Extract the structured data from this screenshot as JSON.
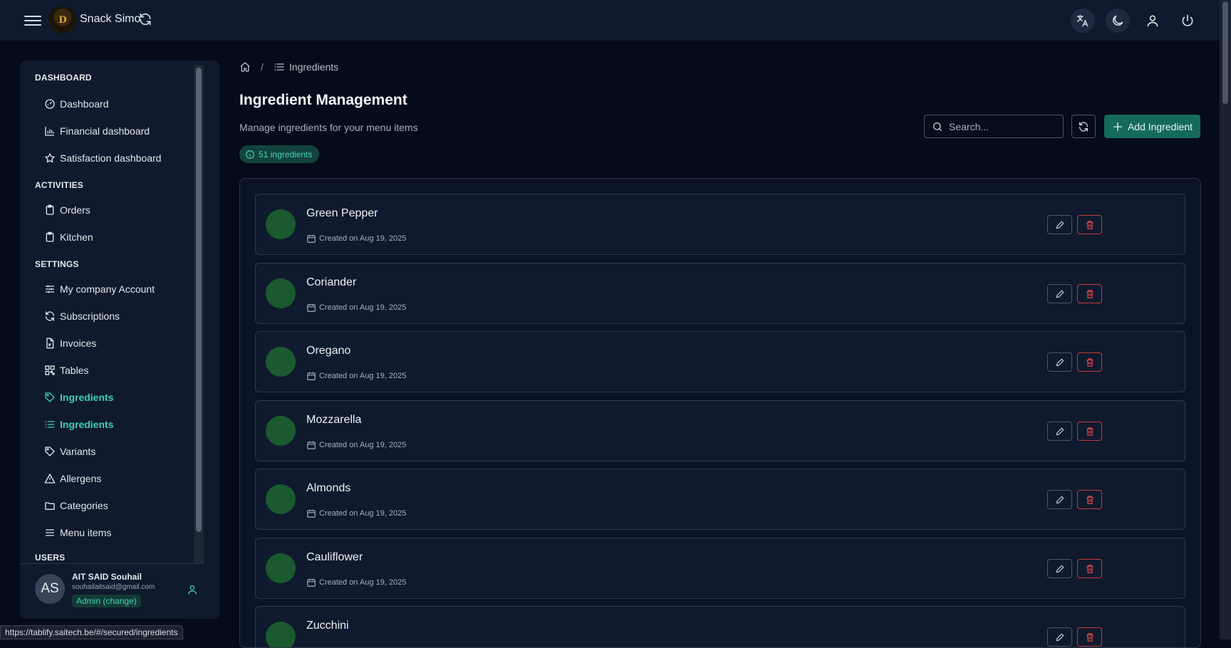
{
  "header": {
    "app_name": "Snack Simo",
    "logo_letter": "D",
    "icons": [
      "translate-icon",
      "moon-icon",
      "user-icon",
      "power-icon"
    ]
  },
  "sidebar": {
    "sections": [
      {
        "title": "DASHBOARD",
        "items": [
          {
            "label": "Dashboard",
            "icon": "dashboard-icon"
          },
          {
            "label": "Financial dashboard",
            "icon": "bar-chart-icon"
          },
          {
            "label": "Satisfaction dashboard",
            "icon": "star-icon"
          }
        ]
      },
      {
        "title": "ACTIVITIES",
        "items": [
          {
            "label": "Orders",
            "icon": "clipboard-icon"
          },
          {
            "label": "Kitchen",
            "icon": "clipboard-icon"
          }
        ]
      },
      {
        "title": "SETTINGS",
        "items": [
          {
            "label": "My company Account",
            "icon": "sliders-icon"
          },
          {
            "label": "Subscriptions",
            "icon": "refresh-icon"
          },
          {
            "label": "Invoices",
            "icon": "file-icon"
          },
          {
            "label": "Tables",
            "icon": "qr-icon"
          },
          {
            "label": "Ingredients",
            "icon": "tag-icon",
            "active": true
          },
          {
            "label": "Ingredients",
            "icon": "list-icon",
            "active": true
          },
          {
            "label": "Variants",
            "icon": "tag-icon"
          },
          {
            "label": "Allergens",
            "icon": "warning-icon"
          },
          {
            "label": "Categories",
            "icon": "folder-icon"
          },
          {
            "label": "Menu items",
            "icon": "menu-icon"
          }
        ]
      },
      {
        "title": "USERS",
        "items": []
      }
    ],
    "user": {
      "initials": "AS",
      "name": "AIT SAID Souhail",
      "email": "souhailaitsaid@gmail.com",
      "role": "Admin (change)"
    }
  },
  "breadcrumb": {
    "current": "Ingredients",
    "separator": "/"
  },
  "main": {
    "title": "Ingredient Management",
    "subtitle": "Manage ingredients for your menu items",
    "count_label": "51 ingredients",
    "search_placeholder": "Search...",
    "add_label": "Add Ingredient"
  },
  "ingredients": [
    {
      "name": "Green Pepper",
      "created": "Created on Aug 19, 2025"
    },
    {
      "name": "Coriander",
      "created": "Created on Aug 19, 2025"
    },
    {
      "name": "Oregano",
      "created": "Created on Aug 19, 2025"
    },
    {
      "name": "Mozzarella",
      "created": "Created on Aug 19, 2025"
    },
    {
      "name": "Almonds",
      "created": "Created on Aug 19, 2025"
    },
    {
      "name": "Cauliflower",
      "created": "Created on Aug 19, 2025"
    },
    {
      "name": "Zucchini",
      "created": ""
    }
  ],
  "status_url": "https://tablify.saitech.be/#/secured/ingredients",
  "colors": {
    "accent": "#3fd0b0",
    "primary_button": "#156a5c",
    "danger": "#c43a3a",
    "ingredient_dot": "#1a5a2e"
  }
}
